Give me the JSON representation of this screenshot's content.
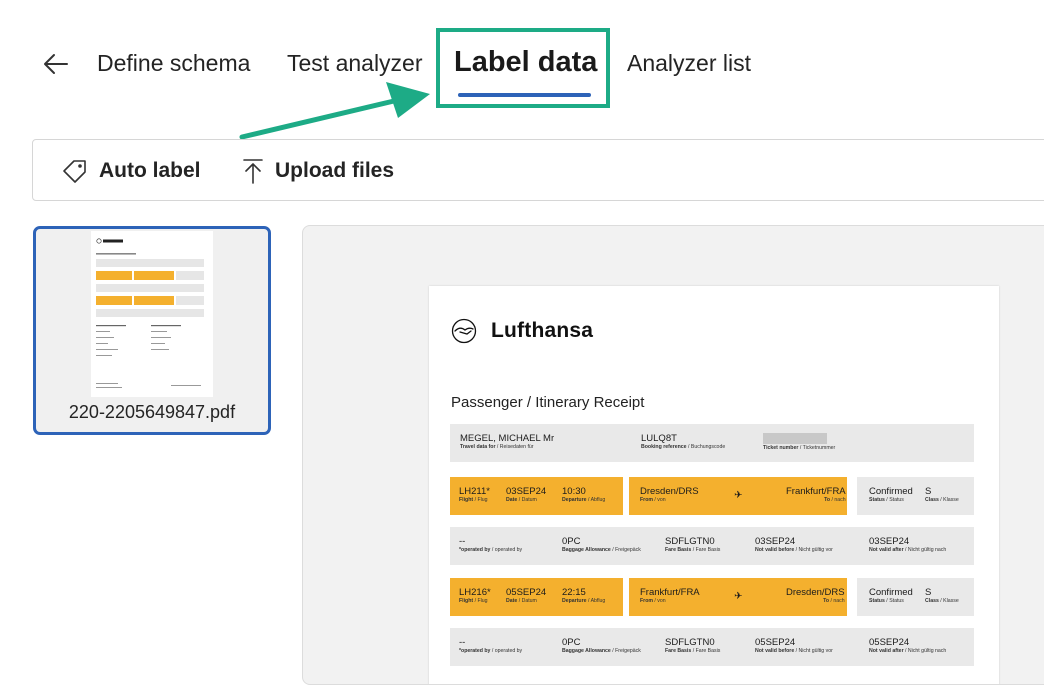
{
  "nav": {
    "tabs": [
      {
        "label": "Define schema"
      },
      {
        "label": "Test analyzer"
      },
      {
        "label": "Label data"
      },
      {
        "label": "Analyzer list"
      }
    ]
  },
  "toolbar": {
    "auto_label": "Auto label",
    "upload_files": "Upload files"
  },
  "file": {
    "name": "220-2205649847.pdf"
  },
  "document": {
    "airline": "Lufthansa",
    "title": "Passenger / Itinerary Receipt",
    "header_row": {
      "passenger_value": "MEGEL, MICHAEL Mr",
      "passenger_key": "Travel data for",
      "passenger_key_alt": "Reisedaten für",
      "booking_value": "LULQ8T",
      "booking_key": "Booking reference",
      "booking_key_alt": "Buchungscode",
      "ticket_key": "Ticket number",
      "ticket_key_alt": "Ticketnummer"
    },
    "flights": [
      {
        "flight": "LH211*",
        "date": "03SEP24",
        "departure": "10:30",
        "from": "Dresden/DRS",
        "to": "Frankfurt/FRA",
        "status": "Confirmed",
        "class": "S",
        "operated_by": "--",
        "baggage": "0PC",
        "fare_basis": "SDFLGTN0",
        "not_before": "03SEP24",
        "not_after": "03SEP24"
      },
      {
        "flight": "LH216*",
        "date": "05SEP24",
        "departure": "22:15",
        "from": "Frankfurt/FRA",
        "to": "Dresden/DRS",
        "status": "Confirmed",
        "class": "S",
        "operated_by": "--",
        "baggage": "0PC",
        "fare_basis": "SDFLGTN0",
        "not_before": "05SEP24",
        "not_after": "05SEP24"
      }
    ],
    "labels": {
      "flight": "Flight",
      "flight_alt": "Flug",
      "date": "Date",
      "date_alt": "Datum",
      "departure": "Departure",
      "departure_alt": "Abflug",
      "from": "From",
      "from_alt": "von",
      "to": "To",
      "to_alt": "nach",
      "status": "Status",
      "status_alt": "Status",
      "class": "Class",
      "class_alt": "Klasse",
      "operated_by": "*operated by",
      "operated_by_alt": "operated by",
      "baggage": "Baggage Allowance",
      "baggage_alt": "Freigepäck",
      "fare_basis": "Fare Basis",
      "fare_basis_alt": "Fare Basis",
      "not_before": "Not valid before",
      "not_before_alt": "Nicht gültig vor",
      "not_after": "Not valid after",
      "not_after_alt": "Nicht gültig nach"
    }
  },
  "colors": {
    "accent": "#2d63b8",
    "highlight": "#1dab86",
    "flight_band": "#f4b02e",
    "info_band": "#e9e9e9"
  }
}
